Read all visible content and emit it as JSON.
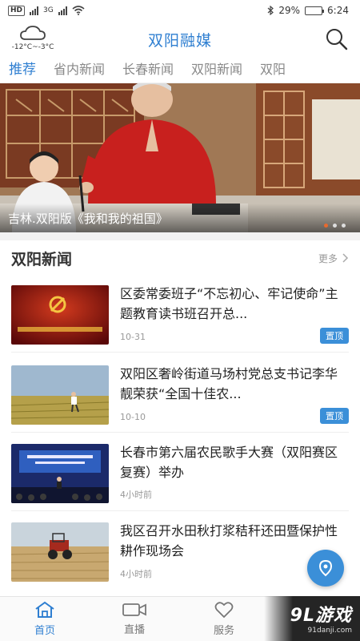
{
  "status_bar": {
    "hd_label": "HD",
    "network_label": "3G",
    "battery_percent": "29%",
    "battery_level": 0.29,
    "time": "6:24"
  },
  "header": {
    "app_title": "双阳融媒",
    "weather_temp": "-12°C~-3°C",
    "weather_icon": "cloud-icon",
    "search_icon": "search-icon"
  },
  "tabs": [
    {
      "label": "推荐",
      "active": true
    },
    {
      "label": "省内新闻",
      "active": false
    },
    {
      "label": "长春新闻",
      "active": false
    },
    {
      "label": "双阳新闻",
      "active": false
    },
    {
      "label": "双阳",
      "active": false
    }
  ],
  "banner": {
    "caption": "吉林.双阳版《我和我的祖国》",
    "slide_count": 3,
    "active_slide": 1
  },
  "section": {
    "title": "双阳新闻",
    "more_label": "更多"
  },
  "news": [
    {
      "title": "区委常委班子“不忘初心、牢记使命”主题教育读书班召开总...",
      "date": "10-31",
      "pin_label": "置顶"
    },
    {
      "title": "双阳区奢岭街道马场村党总支书记李华靓荣获“全国十佳农...",
      "date": "10-10",
      "pin_label": "置顶"
    },
    {
      "title": "长春市第六届农民歌手大赛（双阳赛区复赛）举办",
      "date": "4小时前",
      "pin_label": ""
    },
    {
      "title": "我区召开水田秋打浆秸秆还田暨保护性耕作现场会",
      "date": "4小时前",
      "pin_label": ""
    }
  ],
  "bottom_nav": [
    {
      "label": "首页",
      "icon": "home-icon",
      "active": true
    },
    {
      "label": "直播",
      "icon": "video-camera-icon",
      "active": false
    },
    {
      "label": "服务",
      "icon": "heart-icon",
      "active": false
    }
  ],
  "watermark": {
    "brand": "9L游戏",
    "url": "91danji.com"
  },
  "colors": {
    "accent": "#2f7fd1",
    "pin_bg": "#3b8fd8"
  }
}
